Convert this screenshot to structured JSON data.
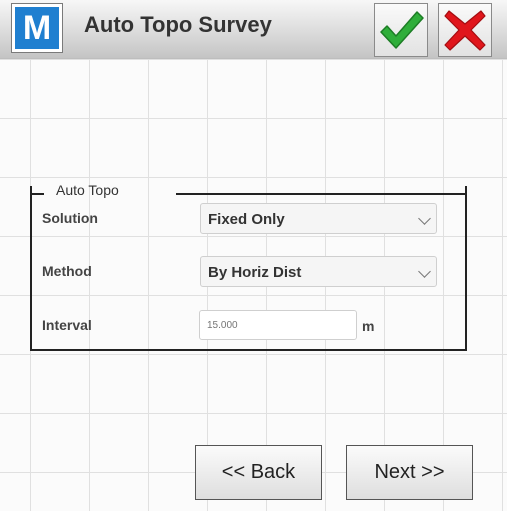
{
  "header": {
    "logo_letter": "M",
    "title": "Auto Topo Survey",
    "ok_icon": "checkmark-icon",
    "cancel_icon": "close-x-icon",
    "ok_color": "#2fae3a",
    "cancel_color": "#e0161c"
  },
  "auto_topo": {
    "legend": "Auto Topo",
    "solution": {
      "label": "Solution",
      "value": "Fixed Only"
    },
    "method": {
      "label": "Method",
      "value": "By Horiz Dist"
    },
    "interval": {
      "label": "Interval",
      "placeholder": "15.000",
      "unit": "m"
    }
  },
  "nav": {
    "back_label": "<< Back",
    "next_label": "Next >>"
  }
}
